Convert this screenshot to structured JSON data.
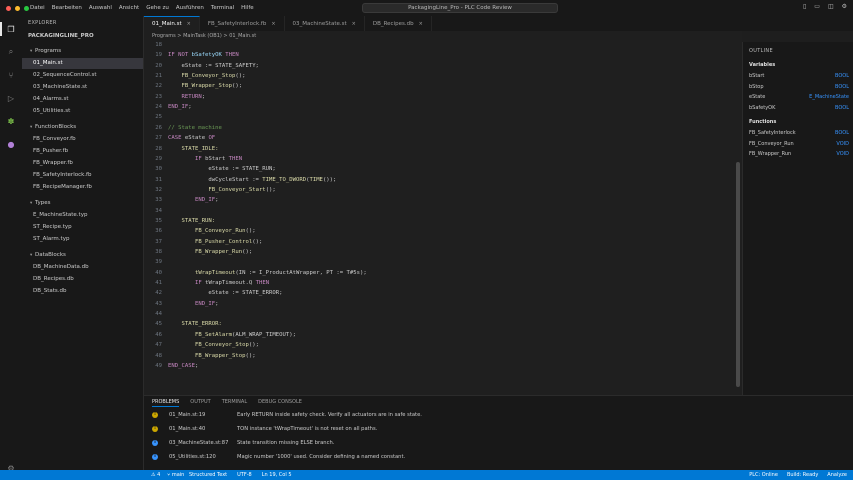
{
  "colors": {
    "accent": "#0078d4",
    "statusbar": "#0078d4",
    "warning": "#cca700",
    "info": "#3794ff",
    "traffic_red": "#ff5f57",
    "traffic_yellow": "#febc2e",
    "traffic_green": "#28c840"
  },
  "titlebar": {
    "menu": [
      "Datei",
      "Bearbeiten",
      "Auswahl",
      "Ansicht",
      "Gehe zu",
      "Ausführen",
      "Terminal",
      "Hilfe"
    ],
    "center_title": "PackagingLine_Pro - PLC Code Review",
    "icons": [
      "layout-sidebar-icon",
      "layout-panel-icon",
      "layout-split-icon",
      "settings-gear-icon"
    ]
  },
  "activity": [
    "files-icon",
    "search-icon",
    "source-control-icon",
    "run-debug-icon",
    "extensions-icon",
    "account-icon",
    "settings-icon"
  ],
  "sidebar": {
    "title": "EXPLORER",
    "project": "PACKAGINGLINE_PRO",
    "tree": [
      {
        "label": "Programs",
        "kind": "folder"
      },
      {
        "label": "01_Main.st",
        "kind": "file",
        "selected": true
      },
      {
        "label": "02_SequenceControl.st",
        "kind": "file"
      },
      {
        "label": "03_MachineState.st",
        "kind": "file"
      },
      {
        "label": "04_Alarms.st",
        "kind": "file"
      },
      {
        "label": "05_Utilities.st",
        "kind": "file"
      },
      {
        "label": "FunctionBlocks",
        "kind": "folder"
      },
      {
        "label": "FB_Conveyor.fb",
        "kind": "file"
      },
      {
        "label": "FB_Pusher.fb",
        "kind": "file"
      },
      {
        "label": "FB_Wrapper.fb",
        "kind": "file"
      },
      {
        "label": "FB_SafetyInterlock.fb",
        "kind": "file"
      },
      {
        "label": "FB_RecipeManager.fb",
        "kind": "file"
      },
      {
        "label": "Types",
        "kind": "folder"
      },
      {
        "label": "E_MachineState.typ",
        "kind": "file"
      },
      {
        "label": "ST_Recipe.typ",
        "kind": "file"
      },
      {
        "label": "ST_Alarm.typ",
        "kind": "file"
      },
      {
        "label": "DataBlocks",
        "kind": "folder"
      },
      {
        "label": "DB_MachineData.db",
        "kind": "file"
      },
      {
        "label": "DB_Recipes.db",
        "kind": "file"
      },
      {
        "label": "DB_Stats.db",
        "kind": "file"
      }
    ]
  },
  "tabs": [
    {
      "label": "01_Main.st",
      "active": true
    },
    {
      "label": "FB_SafetyInterlock.fb",
      "active": false
    },
    {
      "label": "03_MachineState.st",
      "active": false
    },
    {
      "label": "DB_Recipes.db",
      "active": false
    }
  ],
  "breadcrumb": "Programs > MainTask (OB1) > 01_Main.st",
  "editor": {
    "lines": [
      {
        "n": "18",
        "tokens": []
      },
      {
        "n": "19",
        "tokens": [
          {
            "t": "IF NOT ",
            "c": "ctl"
          },
          {
            "t": "bSafetyOK",
            "c": "id"
          },
          {
            "t": " THEN",
            "c": "ctl"
          }
        ]
      },
      {
        "n": "20",
        "tokens": [
          {
            "t": "    eState := STATE_SAFETY;",
            "c": ""
          }
        ]
      },
      {
        "n": "21",
        "tokens": [
          {
            "t": "    ",
            "c": ""
          },
          {
            "t": "FB_Conveyor_Stop",
            "c": "fn"
          },
          {
            "t": "();",
            "c": ""
          }
        ]
      },
      {
        "n": "22",
        "tokens": [
          {
            "t": "    ",
            "c": ""
          },
          {
            "t": "FB_Wrapper_Stop",
            "c": "fn"
          },
          {
            "t": "();",
            "c": ""
          }
        ]
      },
      {
        "n": "23",
        "tokens": [
          {
            "t": "    ",
            "c": ""
          },
          {
            "t": "RETURN",
            "c": "ctl"
          },
          {
            "t": ";",
            "c": ""
          }
        ]
      },
      {
        "n": "24",
        "tokens": [
          {
            "t": "END_IF",
            "c": "ctl"
          },
          {
            "t": ";",
            "c": ""
          }
        ]
      },
      {
        "n": "25",
        "tokens": []
      },
      {
        "n": "26",
        "tokens": [
          {
            "t": "// State machine",
            "c": "cm"
          }
        ]
      },
      {
        "n": "27",
        "tokens": [
          {
            "t": "CASE",
            "c": "ctl"
          },
          {
            "t": " eState ",
            "c": ""
          },
          {
            "t": "OF",
            "c": "ctl"
          }
        ]
      },
      {
        "n": "28",
        "tokens": [
          {
            "t": "    ",
            "c": ""
          },
          {
            "t": "STATE_IDLE:",
            "c": "st"
          }
        ]
      },
      {
        "n": "29",
        "tokens": [
          {
            "t": "        ",
            "c": ""
          },
          {
            "t": "IF",
            "c": "ctl"
          },
          {
            "t": " bStart ",
            "c": ""
          },
          {
            "t": "THEN",
            "c": "ctl"
          }
        ]
      },
      {
        "n": "30",
        "tokens": [
          {
            "t": "            eState := STATE_RUN;",
            "c": ""
          }
        ]
      },
      {
        "n": "31",
        "tokens": [
          {
            "t": "            dwCycleStart := ",
            "c": ""
          },
          {
            "t": "TIME_TO_DWORD",
            "c": "fn"
          },
          {
            "t": "(",
            "c": ""
          },
          {
            "t": "TIME",
            "c": "fn"
          },
          {
            "t": "());",
            "c": ""
          }
        ]
      },
      {
        "n": "32",
        "tokens": [
          {
            "t": "            ",
            "c": ""
          },
          {
            "t": "FB_Conveyor_Start",
            "c": "fn"
          },
          {
            "t": "();",
            "c": ""
          }
        ]
      },
      {
        "n": "33",
        "tokens": [
          {
            "t": "        ",
            "c": ""
          },
          {
            "t": "END_IF",
            "c": "ctl"
          },
          {
            "t": ";",
            "c": ""
          }
        ]
      },
      {
        "n": "34",
        "tokens": []
      },
      {
        "n": "35",
        "tokens": [
          {
            "t": "    ",
            "c": ""
          },
          {
            "t": "STATE_RUN:",
            "c": "st"
          }
        ]
      },
      {
        "n": "36",
        "tokens": [
          {
            "t": "        ",
            "c": ""
          },
          {
            "t": "FB_Conveyor_Run",
            "c": "fn"
          },
          {
            "t": "();",
            "c": ""
          }
        ]
      },
      {
        "n": "37",
        "tokens": [
          {
            "t": "        ",
            "c": ""
          },
          {
            "t": "FB_Pusher_Control",
            "c": "fn"
          },
          {
            "t": "();",
            "c": ""
          }
        ]
      },
      {
        "n": "38",
        "tokens": [
          {
            "t": "        ",
            "c": ""
          },
          {
            "t": "FB_Wrapper_Run",
            "c": "fn"
          },
          {
            "t": "();",
            "c": ""
          }
        ]
      },
      {
        "n": "39",
        "tokens": []
      },
      {
        "n": "40",
        "tokens": [
          {
            "t": "        ",
            "c": ""
          },
          {
            "t": "tWrapTimeout",
            "c": "fn"
          },
          {
            "t": "(IN := I_ProductAtWrapper, PT := T#5s);",
            "c": ""
          }
        ]
      },
      {
        "n": "41",
        "tokens": [
          {
            "t": "        ",
            "c": ""
          },
          {
            "t": "IF",
            "c": "ctl"
          },
          {
            "t": " tWrapTimeout.Q ",
            "c": ""
          },
          {
            "t": "THEN",
            "c": "ctl"
          }
        ]
      },
      {
        "n": "42",
        "tokens": [
          {
            "t": "            eState := STATE_ERROR;",
            "c": ""
          }
        ]
      },
      {
        "n": "43",
        "tokens": [
          {
            "t": "        ",
            "c": ""
          },
          {
            "t": "END_IF",
            "c": "ctl"
          },
          {
            "t": ";",
            "c": ""
          }
        ]
      },
      {
        "n": "44",
        "tokens": []
      },
      {
        "n": "45",
        "tokens": [
          {
            "t": "    ",
            "c": ""
          },
          {
            "t": "STATE_ERROR:",
            "c": "st"
          }
        ]
      },
      {
        "n": "46",
        "tokens": [
          {
            "t": "        ",
            "c": ""
          },
          {
            "t": "FB_SetAlarm",
            "c": "fn"
          },
          {
            "t": "(ALM_WRAP_TIMEOUT);",
            "c": ""
          }
        ]
      },
      {
        "n": "47",
        "tokens": [
          {
            "t": "        ",
            "c": ""
          },
          {
            "t": "FB_Conveyor_Stop",
            "c": "fn"
          },
          {
            "t": "();",
            "c": ""
          }
        ]
      },
      {
        "n": "48",
        "tokens": [
          {
            "t": "        ",
            "c": ""
          },
          {
            "t": "FB_Wrapper_Stop",
            "c": "fn"
          },
          {
            "t": "();",
            "c": ""
          }
        ]
      },
      {
        "n": "49",
        "tokens": [
          {
            "t": "END_CASE",
            "c": "ctl"
          },
          {
            "t": ";",
            "c": ""
          }
        ]
      }
    ]
  },
  "outline": {
    "title": "OUTLINE",
    "variables_label": "Variables",
    "variables": [
      {
        "name": "bStart",
        "type": "BOOL"
      },
      {
        "name": "bStop",
        "type": "BOOL"
      },
      {
        "name": "eState",
        "type": "E_MachineState"
      },
      {
        "name": "bSafetyOK",
        "type": "BOOL"
      }
    ],
    "functions_label": "Functions",
    "functions": [
      {
        "name": "FB_SafetyInterlock",
        "type": "BOOL"
      },
      {
        "name": "FB_Conveyor_Run",
        "type": "VOID"
      },
      {
        "name": "FB_Wrapper_Run",
        "type": "VOID"
      }
    ]
  },
  "panel": {
    "tabs": [
      {
        "label": "PROBLEMS",
        "active": true
      },
      {
        "label": "OUTPUT",
        "active": false
      },
      {
        "label": "TERMINAL",
        "active": false
      },
      {
        "label": "DEBUG CONSOLE",
        "active": false
      }
    ],
    "problems": [
      {
        "severity": "warning",
        "glyph": "!",
        "location": "01_Main.st:19",
        "message": "Early RETURN inside safety check. Verify all actuators are in safe state."
      },
      {
        "severity": "warning",
        "glyph": "!",
        "location": "01_Main.st:40",
        "message": "TON instance 'tWrapTimeout' is not reset on all paths."
      },
      {
        "severity": "info",
        "glyph": "i",
        "location": "03_MachineState.st:87",
        "message": "State transition missing ELSE branch."
      },
      {
        "severity": "info",
        "glyph": "i",
        "location": "05_Utilities.st:120",
        "message": "Magic number '1000' used. Consider defining a named constant."
      }
    ]
  },
  "statusbar": {
    "errors": "4",
    "branch": "main",
    "language": "Structured Text",
    "encoding": "UTF-8",
    "position": "Ln 19, Col 5",
    "right": [
      "PLC: Online",
      "Build: Ready",
      "Analyze"
    ]
  }
}
